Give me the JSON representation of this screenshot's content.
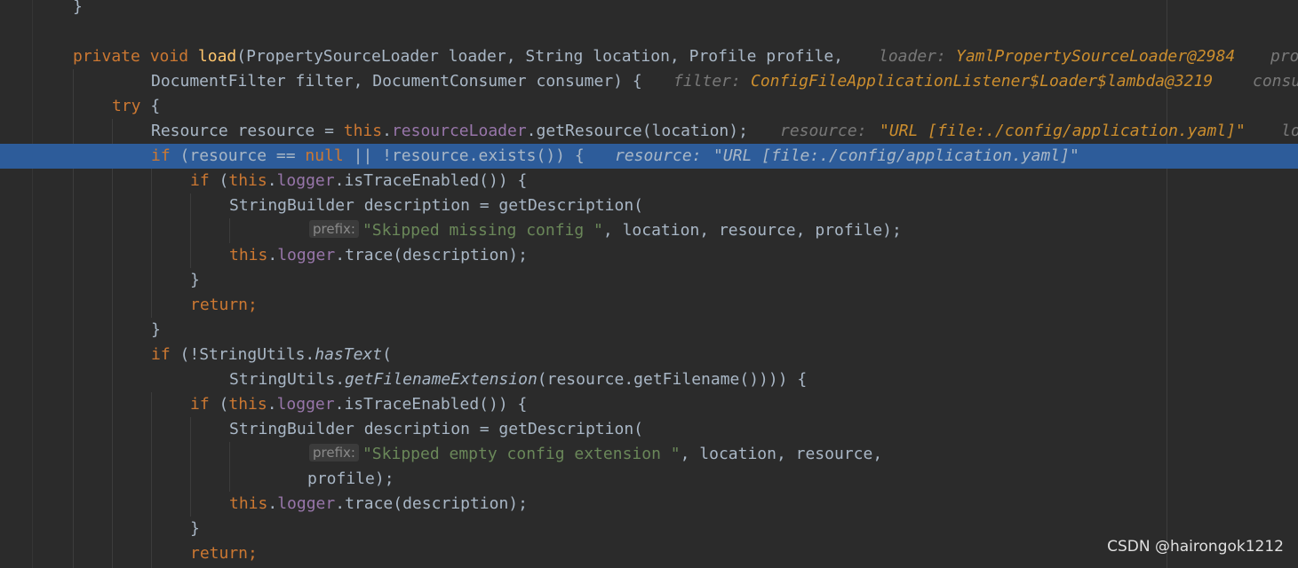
{
  "editor": {
    "colors": {
      "background": "#2b2b2b",
      "highlight": "#2d5c9a",
      "keyword": "#cc7832",
      "method": "#ffc66d",
      "field": "#9876aa",
      "string": "#6a8759",
      "default": "#a9b7c6",
      "hint": "#787878",
      "hint_value": "#cc8e2e"
    },
    "lines": {
      "l0": {
        "brace": "}"
      },
      "l2": {
        "kw_private": "private",
        "kw_void": "void",
        "method": "load",
        "params": "(PropertySourceLoader loader, String location, Profile profile,",
        "hint1_label": "loader:",
        "hint1_value": "YamlPropertySourceLoader@2984",
        "hint2_label": "pro"
      },
      "l3": {
        "params": "DocumentFilter filter, DocumentConsumer consumer) {",
        "hint1_label": "filter:",
        "hint1_value": "ConfigFileApplicationListener$Loader$lambda@3219",
        "hint2_label": "consu"
      },
      "l4": {
        "kw_try": "try",
        "brace": "{"
      },
      "l5": {
        "pre": "Resource resource = ",
        "kw_this": "this",
        "dot": ".",
        "field": "resourceLoader",
        "post": ".getResource(location);",
        "hint1_label": "resource:",
        "hint1_value": "\"URL [file:./config/application.yaml]\"",
        "hint2_label": "lo"
      },
      "l6": {
        "kw_if": "if",
        "pre": " (resource == ",
        "kw_null": "null",
        "post": " || !resource.exists()) {",
        "hint1_label": "resource:",
        "hint1_value": "\"URL [file:./config/application.yaml]\""
      },
      "l7": {
        "kw_if": "if",
        "pre": " (",
        "kw_this": "this",
        "dot": ".",
        "field": "logger",
        "post": ".isTraceEnabled()) {"
      },
      "l8": {
        "text": "StringBuilder description = getDescription("
      },
      "l9": {
        "param_hint": "prefix:",
        "str": "\"Skipped missing config \"",
        "post": ", location, resource, profile);"
      },
      "l10": {
        "kw_this": "this",
        "dot": ".",
        "field": "logger",
        "post": ".trace(description);"
      },
      "l11": {
        "brace": "}"
      },
      "l12": {
        "kw_return": "return;"
      },
      "l13": {
        "brace": "}"
      },
      "l14": {
        "kw_if": "if",
        "pre": " (!StringUtils.",
        "static_m": "hasText",
        "post": "("
      },
      "l15": {
        "pre": "StringUtils.",
        "static_m": "getFilenameExtension",
        "post": "(resource.getFilename()))) {"
      },
      "l16": {
        "kw_if": "if",
        "pre": " (",
        "kw_this": "this",
        "dot": ".",
        "field": "logger",
        "post": ".isTraceEnabled()) {"
      },
      "l17": {
        "text": "StringBuilder description = getDescription("
      },
      "l18": {
        "param_hint": "prefix:",
        "str": "\"Skipped empty config extension \"",
        "post": ", location, resource,"
      },
      "l19": {
        "text": "profile);"
      },
      "l20": {
        "kw_this": "this",
        "dot": ".",
        "field": "logger",
        "post": ".trace(description);"
      },
      "l21": {
        "brace": "}"
      },
      "l22": {
        "kw_return": "return;"
      }
    }
  },
  "watermark": "CSDN @hairongok1212"
}
